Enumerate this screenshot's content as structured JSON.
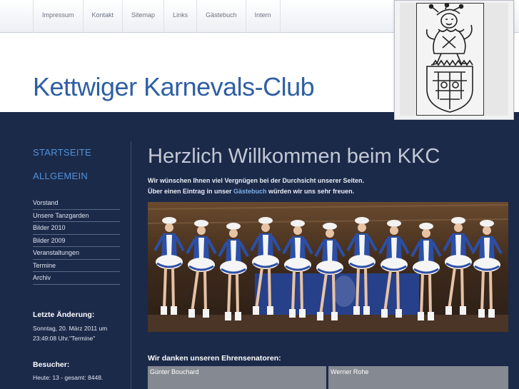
{
  "topnav": [
    "Impressum",
    "Kontakt",
    "Sitemap",
    "Links",
    "Gästebuch",
    "Intern"
  ],
  "site_title": "Kettwiger Karnevals-Club",
  "sidebar": {
    "main": [
      "STARTSEITE",
      "ALLGEMEIN"
    ],
    "sub": [
      "Vorstand",
      "Unsere Tanzgarden",
      "Bilder 2010",
      "Bilder 2009",
      "Veranstaltungen",
      "Termine",
      "Archiv"
    ],
    "last_change_heading": "Letzte Änderung:",
    "last_change_line1": "Sonntag, 20. März 2011 um",
    "last_change_line2": "23:49:08 Uhr.\"Termine\"",
    "visitors_heading": "Besucher:",
    "visitors_text": "Heute: 13 - gesamt: 8448."
  },
  "content": {
    "welcome": "Herzlich Willkommen beim KKC",
    "intro_line1": "Wir wünschen Ihnen viel Vergnügen bei der Durchsicht unserer Seiten.",
    "intro_line2_a": "Über einen Eintrag in unser ",
    "intro_line2_link": "Gästebuch",
    "intro_line2_b": " würden wir uns sehr freuen.",
    "thanks_heading": "Wir danken unseren Ehrensenatoren:",
    "senators": [
      "Günter Bouchard",
      "Werner Rohe"
    ]
  },
  "colors": {
    "page_bg": "#1c2a4a",
    "title_blue": "#2f5fa3",
    "nav_blue": "#4f93d9",
    "cell_gray": "#858991"
  }
}
